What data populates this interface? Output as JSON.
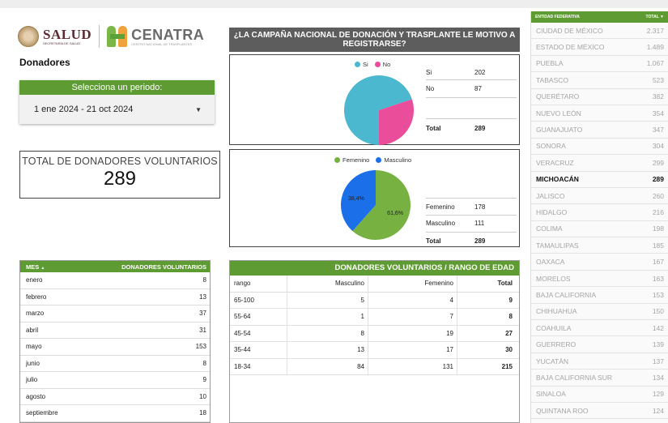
{
  "header": {
    "salud_logo": "SALUD",
    "salud_sub": "SECRETARÍA DE SALUD",
    "cenatra_logo": "CENATRA",
    "cenatra_sub": "CENTRO NACIONAL DE TRASPLANTES"
  },
  "page_title": "Donadores",
  "period": {
    "label": "Selecciona un periodo:",
    "value": "1 ene 2024 - 21 oct 2024"
  },
  "total": {
    "label": "TOTAL DE DONADORES VOLUNTARIOS",
    "value": "289"
  },
  "campaign": {
    "title": "¿LA CAMPAÑA NACIONAL DE DONACIÓN Y TRASPLANTE LE MOTIVO A REGISTRARSE?",
    "legend": [
      "Si",
      "No"
    ],
    "rows": [
      {
        "label": "Si",
        "value": "202"
      },
      {
        "label": "No",
        "value": "87"
      }
    ],
    "total_label": "Total",
    "total_value": "289"
  },
  "gender": {
    "legend": [
      "Femenino",
      "Masculino"
    ],
    "slice_labels": [
      "61,6%",
      "38,4%"
    ],
    "rows": [
      {
        "label": "Femenino",
        "value": "178"
      },
      {
        "label": "Masculino",
        "value": "111"
      }
    ],
    "total_label": "Total",
    "total_value": "289"
  },
  "months": {
    "col_mes": "MES",
    "sort_icon": "▲",
    "col_donadores": "DONADORES VOLUNTARIOS",
    "rows": [
      {
        "mes": "enero",
        "valor": "8"
      },
      {
        "mes": "febrero",
        "valor": "13"
      },
      {
        "mes": "marzo",
        "valor": "37"
      },
      {
        "mes": "abril",
        "valor": "31"
      },
      {
        "mes": "mayo",
        "valor": "153"
      },
      {
        "mes": "junio",
        "valor": "8"
      },
      {
        "mes": "julio",
        "valor": "9"
      },
      {
        "mes": "agosto",
        "valor": "10"
      },
      {
        "mes": "septiembre",
        "valor": "18"
      }
    ]
  },
  "age": {
    "title": "DONADORES VOLUNTARIOS / RANGO DE EDAD",
    "headers": [
      "rango",
      "Masculino",
      "Femenino",
      "Total"
    ],
    "rows": [
      [
        "65-100",
        "5",
        "4",
        "9"
      ],
      [
        "55-64",
        "1",
        "7",
        "8"
      ],
      [
        "45-54",
        "8",
        "19",
        "27"
      ],
      [
        "35-44",
        "13",
        "17",
        "30"
      ],
      [
        "18-34",
        "84",
        "131",
        "215"
      ]
    ]
  },
  "states": {
    "col_entidad": "ENTIDAD FEDERATIVA",
    "col_total": "TOTAL ▼",
    "rows": [
      {
        "name": "CIUDAD DE MÉXICO",
        "total": "2.317"
      },
      {
        "name": "ESTADO DE MÉXICO",
        "total": "1.489"
      },
      {
        "name": "PUEBLA",
        "total": "1.067"
      },
      {
        "name": "TABASCO",
        "total": "523"
      },
      {
        "name": "QUERÉTARO",
        "total": "382"
      },
      {
        "name": "NUEVO LEÓN",
        "total": "354"
      },
      {
        "name": "GUANAJUATO",
        "total": "347"
      },
      {
        "name": "SONORA",
        "total": "304"
      },
      {
        "name": "VERACRUZ",
        "total": "299"
      },
      {
        "name": "MICHOACÁN",
        "total": "289"
      },
      {
        "name": "JALISCO",
        "total": "260"
      },
      {
        "name": "HIDALGO",
        "total": "216"
      },
      {
        "name": "COLIMA",
        "total": "198"
      },
      {
        "name": "TAMAULIPAS",
        "total": "185"
      },
      {
        "name": "OAXACA",
        "total": "167"
      },
      {
        "name": "MORELOS",
        "total": "163"
      },
      {
        "name": "BAJA CALIFORNIA",
        "total": "153"
      },
      {
        "name": "CHIHUAHUA",
        "total": "150"
      },
      {
        "name": "COAHUILA",
        "total": "142"
      },
      {
        "name": "GUERRERO",
        "total": "139"
      },
      {
        "name": "YUCATÁN",
        "total": "137"
      },
      {
        "name": "BAJA CALIFORNIA SUR",
        "total": "134"
      },
      {
        "name": "SINALOA",
        "total": "129"
      },
      {
        "name": "QUINTANA ROO",
        "total": "124"
      }
    ],
    "highlight": "MICHOACÁN"
  },
  "colors": {
    "green": "#5f9b33",
    "si": "#4bb8cf",
    "no": "#ea4d9a",
    "femenino": "#76b142",
    "masculino": "#1b6fe8"
  },
  "chart_data": [
    {
      "type": "pie",
      "categories": [
        "Si",
        "No"
      ],
      "values": [
        202,
        87
      ]
    },
    {
      "type": "pie",
      "categories": [
        "Femenino",
        "Masculino"
      ],
      "values": [
        178,
        111
      ]
    }
  ]
}
